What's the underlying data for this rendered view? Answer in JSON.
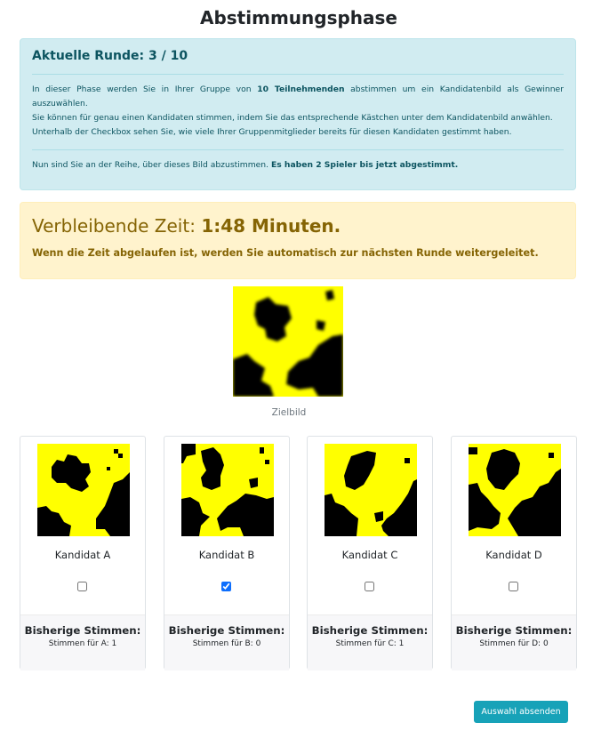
{
  "page": {
    "title": "Abstimmungsphase"
  },
  "info": {
    "heading": "Aktuelle Runde: 3 / 10",
    "p1_before": "In dieser Phase werden Sie in Ihrer Gruppe von ",
    "p1_bold": "10 Teilnehmenden",
    "p1_after": " abstimmen um ein Kandidatenbild als Gewinner auszuwählen.",
    "p2": "Sie können für genau einen Kandidaten stimmen, indem Sie das entsprechende Kästchen unter dem Kandidatenbild anwählen.",
    "p3": "Unterhalb der Checkbox sehen Sie, wie viele Ihrer Gruppenmitglieder bereits für diesen Kandidaten gestimmt haben.",
    "p4_before": "Nun sind Sie an der Reihe, über dieses Bild abzustimmen. ",
    "p4_bold": "Es haben 2 Spieler bis jetzt abgestimmt."
  },
  "timer": {
    "label": "Verbleibende Zeit: ",
    "value": "1:48 Minuten.",
    "note": "Wenn die Zeit abgelaufen ist, werden Sie automatisch zur nächsten Runde weitergeleitet."
  },
  "target": {
    "caption": "Zielbild"
  },
  "colors": {
    "pattern_fill": "#ffff00",
    "pattern_ink": "#000000",
    "accent": "#17a2b8"
  },
  "candidates": [
    {
      "name": "Kandidat A",
      "checked": false,
      "votes_heading": "Bisherige Stimmen:",
      "votes_text": "Stimmen für A: 1"
    },
    {
      "name": "Kandidat B",
      "checked": true,
      "votes_heading": "Bisherige Stimmen:",
      "votes_text": "Stimmen für B: 0"
    },
    {
      "name": "Kandidat C",
      "checked": false,
      "votes_heading": "Bisherige Stimmen:",
      "votes_text": "Stimmen für C: 1"
    },
    {
      "name": "Kandidat D",
      "checked": false,
      "votes_heading": "Bisherige Stimmen:",
      "votes_text": "Stimmen für D: 0"
    }
  ],
  "submit": {
    "label": "Auswahl absenden"
  }
}
